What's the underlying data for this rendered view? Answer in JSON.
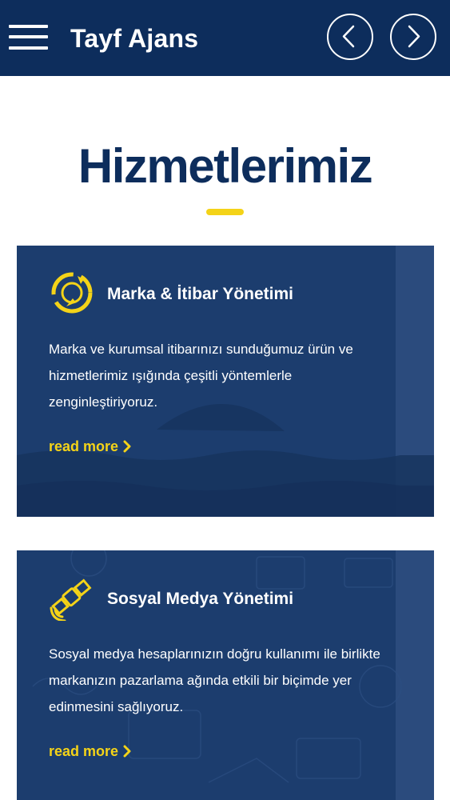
{
  "header": {
    "brand": "Tayf Ajans",
    "menu_icon": "hamburger-menu-icon",
    "prev_icon": "chevron-left-icon",
    "next_icon": "chevron-right-icon"
  },
  "section": {
    "title": "Hizmetlerimiz"
  },
  "cards": [
    {
      "icon": "reputation-cycle-icon",
      "title": "Marka & İtibar Yönetimi",
      "description": "Marka ve kurumsal itibarınızı sunduğumuz ürün ve hizmetlerimiz ışığında çeşitli yöntemlerle zenginleştiriyoruz.",
      "link": "read more"
    },
    {
      "icon": "satellite-icon",
      "title": "Sosyal Medya Yönetimi",
      "description": "Sosyal medya hesaplarınızın doğru kullanımı ile birlikte markanızın pazarlama ağında etkili bir biçimde  yer edinmesini sağlıyoruz.",
      "link": "read more"
    }
  ],
  "colors": {
    "header_bg": "#0d2d5c",
    "title": "#0d2d5c",
    "accent": "#f4d318",
    "card_bg": "#1c3d6e"
  }
}
